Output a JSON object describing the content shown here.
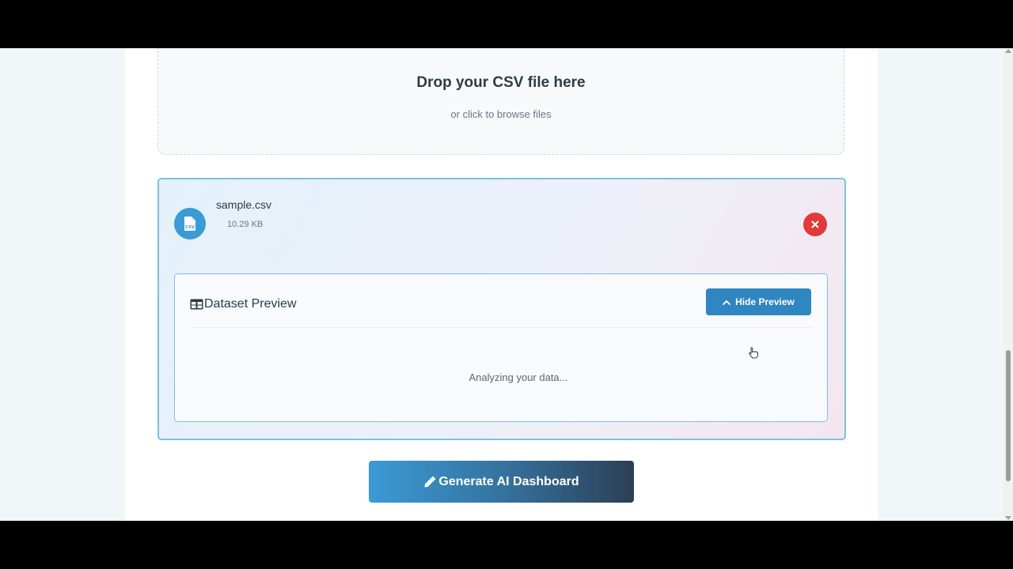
{
  "dropzone": {
    "title": "Drop your CSV file here",
    "subtitle": "or click to browse files"
  },
  "file": {
    "icon": "csv-file-icon",
    "icon_label": "CSV",
    "name": "sample.csv",
    "size": "10.29 KB",
    "remove_icon": "close-icon"
  },
  "preview": {
    "icon": "table-icon",
    "title": "Dataset Preview",
    "toggle_icon": "chevron-up-icon",
    "toggle_label": "Hide Preview",
    "status": "Analyzing your data..."
  },
  "generate": {
    "icon": "pencil-icon",
    "label": "Generate AI Dashboard"
  },
  "colors": {
    "accent": "#3a9bd5",
    "remove": "#e13a3a",
    "panel_border": "#7cc0e2"
  }
}
